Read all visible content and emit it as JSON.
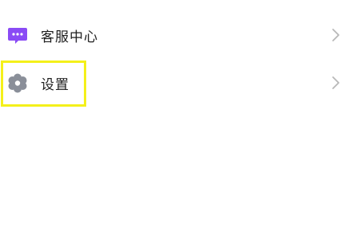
{
  "menu": {
    "items": [
      {
        "label": "客服中心",
        "icon": "chat-bubble-icon",
        "icon_color": "#8a4bf5"
      },
      {
        "label": "设置",
        "icon": "gear-icon",
        "icon_color": "#8a8f99"
      }
    ],
    "chevron_color": "#b8b8b8"
  },
  "highlight": {
    "color": "#f4f01a"
  }
}
